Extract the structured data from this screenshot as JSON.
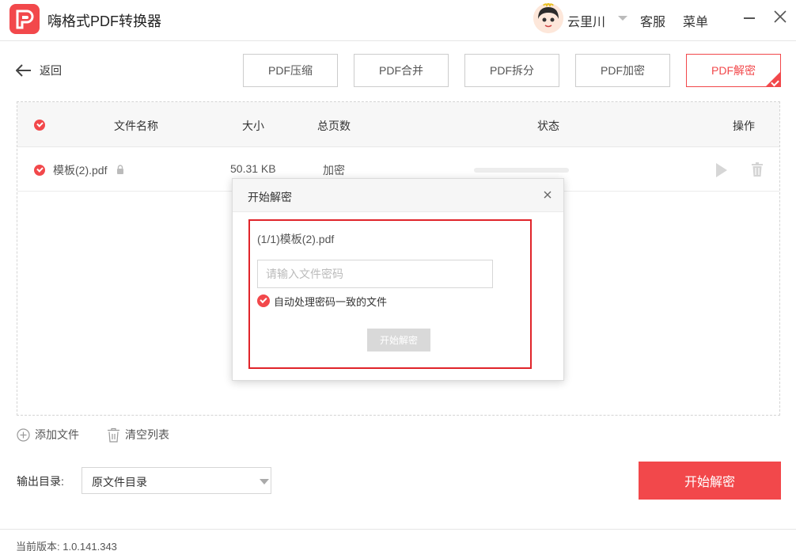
{
  "app": {
    "title": "嗨格式PDF转换器",
    "brand_color": "#f2484b"
  },
  "header": {
    "username": "云里川",
    "service_label": "客服",
    "menu_label": "菜单"
  },
  "toolbar": {
    "back_label": "返回",
    "tabs": [
      {
        "label": "PDF压缩",
        "active": false
      },
      {
        "label": "PDF合并",
        "active": false
      },
      {
        "label": "PDF拆分",
        "active": false
      },
      {
        "label": "PDF加密",
        "active": false
      },
      {
        "label": "PDF解密",
        "active": true
      }
    ]
  },
  "table": {
    "columns": [
      "文件名称",
      "大小",
      "总页数",
      "状态",
      "操作"
    ],
    "rows": [
      {
        "name": "模板(2).pdf",
        "size": "50.31 KB",
        "pages": "加密",
        "progress": 0
      }
    ]
  },
  "modal": {
    "title": "开始解密",
    "file_label": "(1/1)模板(2).pdf",
    "password_placeholder": "请输入文件密码",
    "password_value": "",
    "auto_label": "自动处理密码一致的文件",
    "start_label": "开始解密"
  },
  "actions": {
    "add_file_label": "添加文件",
    "clear_list_label": "清空列表"
  },
  "output": {
    "label": "输出目录:",
    "selected": "原文件目录"
  },
  "main_button_label": "开始解密",
  "footer": {
    "version": "当前版本: 1.0.141.343"
  }
}
